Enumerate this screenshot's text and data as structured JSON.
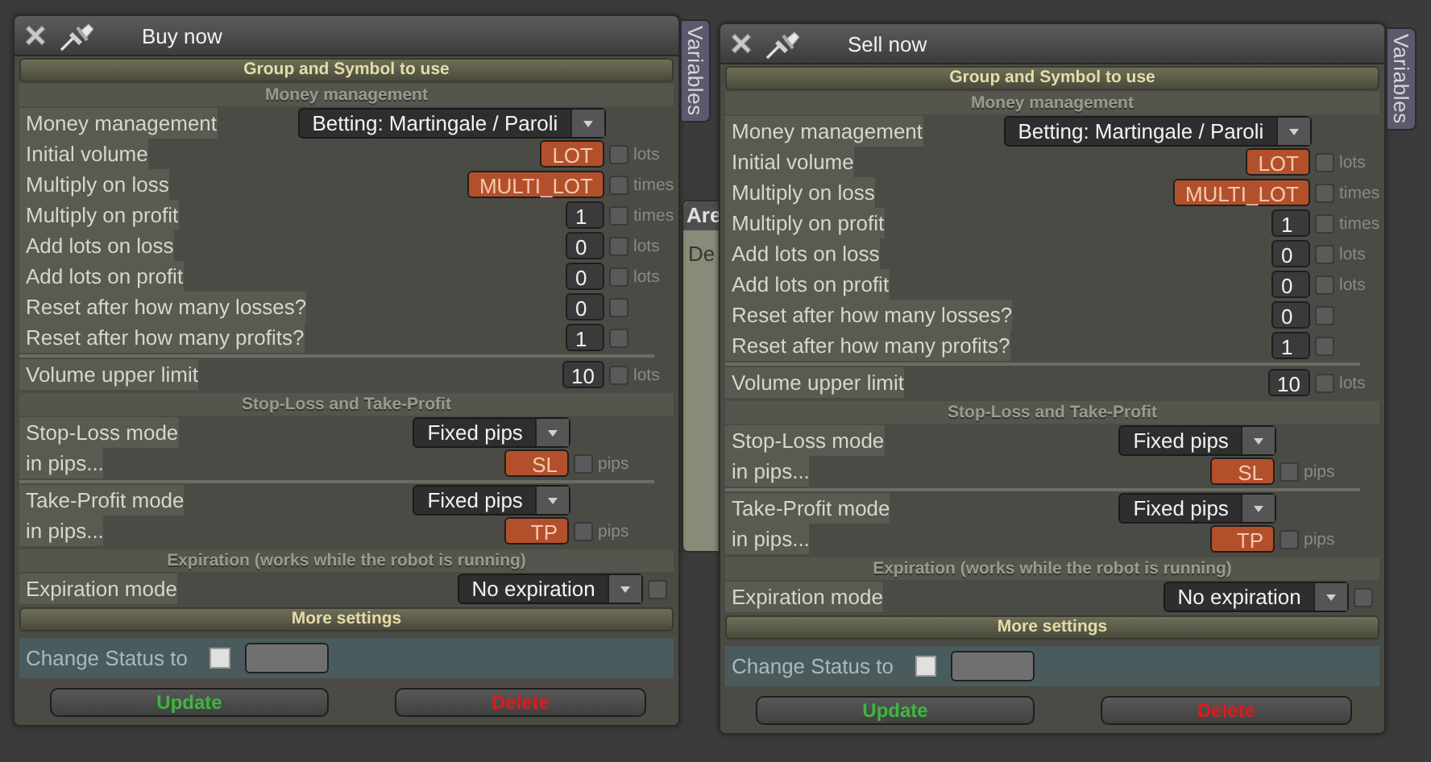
{
  "background_window": {
    "tab": "Are",
    "text": "De"
  },
  "panels": [
    {
      "title": "Buy now",
      "side_tab": "Variables",
      "blocks": [
        {
          "kind": "banner",
          "text": "Group and Symbol to use"
        },
        {
          "kind": "inputs",
          "title": "Money management",
          "groups": [
            [
              {
                "label": "Money management",
                "control": {
                  "kind": "select",
                  "value": "Betting: Martingale / Paroli"
                }
              },
              {
                "label": "Initial volume",
                "control": {
                  "kind": "number",
                  "value": "LOT",
                  "variable": true
                },
                "option": {
                  "checked": false,
                  "unit": "lots"
                }
              },
              {
                "label": "Multiply on loss",
                "control": {
                  "kind": "number",
                  "value": "MULTI_LOT",
                  "variable": true
                },
                "option": {
                  "checked": false,
                  "unit": "times"
                }
              },
              {
                "label": "Multiply on profit",
                "control": {
                  "kind": "number",
                  "value": "1",
                  "variable": false
                },
                "option": {
                  "checked": false,
                  "unit": "times"
                }
              },
              {
                "label": "Add lots on loss",
                "control": {
                  "kind": "number",
                  "value": "0",
                  "variable": false
                },
                "option": {
                  "checked": false,
                  "unit": "lots"
                }
              },
              {
                "label": "Add lots on profit",
                "control": {
                  "kind": "number",
                  "value": "0",
                  "variable": false
                },
                "option": {
                  "checked": false,
                  "unit": "lots"
                }
              },
              {
                "label": "Reset after how many losses?",
                "control": {
                  "kind": "number",
                  "value": "0",
                  "variable": false
                },
                "option": {
                  "checked": false
                }
              },
              {
                "label": "Reset after how many profits?",
                "control": {
                  "kind": "number",
                  "value": "1",
                  "variable": false
                },
                "option": {
                  "checked": false
                }
              }
            ],
            [
              {
                "label": "Volume upper limit",
                "control": {
                  "kind": "number",
                  "value": "10",
                  "variable": false
                },
                "option": {
                  "checked": false,
                  "unit": "lots"
                }
              }
            ]
          ]
        },
        {
          "kind": "modes",
          "title": "Stop-Loss and Take-Profit",
          "groups": [
            [
              {
                "label": "Stop-Loss mode",
                "control": {
                  "kind": "select",
                  "value": "Fixed pips"
                }
              },
              {
                "label": "in pips...",
                "control": {
                  "kind": "number",
                  "value": "SL",
                  "variable": true
                },
                "option": {
                  "checked": false,
                  "unit": "pips"
                }
              }
            ],
            [
              {
                "label": "Take-Profit mode",
                "control": {
                  "kind": "select",
                  "value": "Fixed pips"
                }
              },
              {
                "label": "in pips...",
                "control": {
                  "kind": "number",
                  "value": "TP",
                  "variable": true
                },
                "option": {
                  "checked": false,
                  "unit": "pips"
                }
              }
            ]
          ]
        },
        {
          "kind": "expiry",
          "title": "Expiration (works while the robot is running)",
          "groups": [
            [
              {
                "label": "Expiration mode",
                "control": {
                  "kind": "select",
                  "value": "No expiration"
                },
                "option": {
                  "checked": false
                }
              }
            ]
          ]
        },
        {
          "kind": "banner",
          "text": "More settings"
        },
        {
          "kind": "status",
          "label": "Change Status to",
          "checked": false
        }
      ],
      "buttons": [
        {
          "label": "Update",
          "kind": "confirm"
        },
        {
          "label": "Delete",
          "kind": "danger"
        }
      ]
    },
    {
      "title": "Sell now",
      "side_tab": "Variables",
      "blocks": [
        {
          "kind": "banner",
          "text": "Group and Symbol to use"
        },
        {
          "kind": "inputs",
          "title": "Money management",
          "groups": [
            [
              {
                "label": "Money management",
                "control": {
                  "kind": "select",
                  "value": "Betting: Martingale / Paroli"
                }
              },
              {
                "label": "Initial volume",
                "control": {
                  "kind": "number",
                  "value": "LOT",
                  "variable": true
                },
                "option": {
                  "checked": false,
                  "unit": "lots"
                }
              },
              {
                "label": "Multiply on loss",
                "control": {
                  "kind": "number",
                  "value": "MULTI_LOT",
                  "variable": true
                },
                "option": {
                  "checked": false,
                  "unit": "times"
                }
              },
              {
                "label": "Multiply on profit",
                "control": {
                  "kind": "number",
                  "value": "1",
                  "variable": false
                },
                "option": {
                  "checked": false,
                  "unit": "times"
                }
              },
              {
                "label": "Add lots on loss",
                "control": {
                  "kind": "number",
                  "value": "0",
                  "variable": false
                },
                "option": {
                  "checked": false,
                  "unit": "lots"
                }
              },
              {
                "label": "Add lots on profit",
                "control": {
                  "kind": "number",
                  "value": "0",
                  "variable": false
                },
                "option": {
                  "checked": false,
                  "unit": "lots"
                }
              },
              {
                "label": "Reset after how many losses?",
                "control": {
                  "kind": "number",
                  "value": "0",
                  "variable": false
                },
                "option": {
                  "checked": false
                }
              },
              {
                "label": "Reset after how many profits?",
                "control": {
                  "kind": "number",
                  "value": "1",
                  "variable": false
                },
                "option": {
                  "checked": false
                }
              }
            ],
            [
              {
                "label": "Volume upper limit",
                "control": {
                  "kind": "number",
                  "value": "10",
                  "variable": false
                },
                "option": {
                  "checked": false,
                  "unit": "lots"
                }
              }
            ]
          ]
        },
        {
          "kind": "modes",
          "title": "Stop-Loss and Take-Profit",
          "groups": [
            [
              {
                "label": "Stop-Loss mode",
                "control": {
                  "kind": "select",
                  "value": "Fixed pips"
                }
              },
              {
                "label": "in pips...",
                "control": {
                  "kind": "number",
                  "value": "SL",
                  "variable": true
                },
                "option": {
                  "checked": false,
                  "unit": "pips"
                }
              }
            ],
            [
              {
                "label": "Take-Profit mode",
                "control": {
                  "kind": "select",
                  "value": "Fixed pips"
                }
              },
              {
                "label": "in pips...",
                "control": {
                  "kind": "number",
                  "value": "TP",
                  "variable": true
                },
                "option": {
                  "checked": false,
                  "unit": "pips"
                }
              }
            ]
          ]
        },
        {
          "kind": "expiry",
          "title": "Expiration (works while the robot is running)",
          "groups": [
            [
              {
                "label": "Expiration mode",
                "control": {
                  "kind": "select",
                  "value": "No expiration"
                },
                "option": {
                  "checked": false
                }
              }
            ]
          ]
        },
        {
          "kind": "banner",
          "text": "More settings"
        },
        {
          "kind": "status",
          "label": "Change Status to",
          "checked": false
        }
      ],
      "buttons": [
        {
          "label": "Update",
          "kind": "confirm"
        },
        {
          "label": "Delete",
          "kind": "danger"
        }
      ]
    }
  ]
}
